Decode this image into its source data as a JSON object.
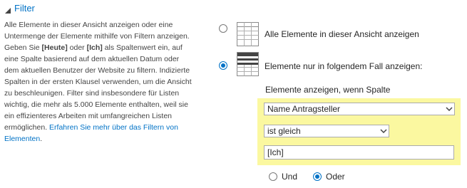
{
  "section": {
    "title": "Filter"
  },
  "description": {
    "part1": "Alle Elemente in dieser Ansicht anzeigen oder eine Untermenge der Elemente mithilfe von Filtern anzeigen. Geben Sie ",
    "kw_today": "[Heute]",
    "part2": " oder ",
    "kw_me": "[Ich]",
    "part3": " als Spaltenwert ein, auf eine Spalte basierend auf dem aktuellen Datum oder dem aktuellen Benutzer der Website zu filtern. Indizierte Spalten in der ersten Klausel verwenden, um die Ansicht zu beschleunigen. Filter sind insbesondere für Listen wichtig, die mehr als 5.000 Elemente enthalten, weil sie ein effizienteres Arbeiten mit umfangreichen Listen ermöglichen. ",
    "link": "Erfahren Sie mehr über das Filtern von Elementen",
    "part4": "."
  },
  "options": {
    "all_label": "Alle Elemente in dieser Ansicht anzeigen",
    "filtered_label": "Elemente nur in folgendem Fall anzeigen:",
    "selected": "filtered"
  },
  "condition": {
    "label": "Elemente anzeigen, wenn Spalte",
    "column_value": "Name Antragsteller",
    "operator_value": "ist gleich",
    "value": "[Ich]"
  },
  "logic": {
    "and_label": "Und",
    "or_label": "Oder",
    "selected": "or"
  },
  "colors": {
    "accent": "#0072c6",
    "highlight": "#fbf8a0"
  },
  "icons": {
    "collapse": "collapse-triangle-icon",
    "all_items": "grid-icon",
    "filtered_items": "filtered-grid-icon",
    "dropdown": "chevron-down-icon"
  }
}
